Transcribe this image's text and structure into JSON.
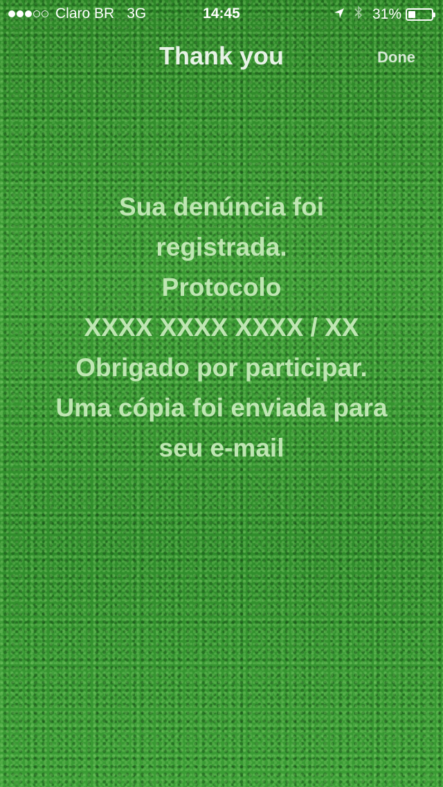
{
  "status_bar": {
    "carrier": "Claro BR",
    "network": "3G",
    "time": "14:45",
    "battery_percent": "31%",
    "battery_level": 0.31,
    "signal_bars_filled": 3,
    "signal_bars_total": 5,
    "icons": [
      "location-arrow-icon",
      "bluetooth-icon",
      "battery-icon"
    ]
  },
  "nav": {
    "title": "Thank you",
    "done_label": "Done"
  },
  "message": {
    "lines": [
      "Sua denúncia foi",
      "registrada.",
      "Protocolo",
      "XXXX XXXX XXXX / XX",
      "Obrigado por participar.",
      "Uma cópia foi enviada para",
      "seu e-mail"
    ]
  },
  "colors": {
    "background": "#2f8a2a",
    "message_text": "#bfe6b3",
    "status_text": "#ffffff"
  }
}
